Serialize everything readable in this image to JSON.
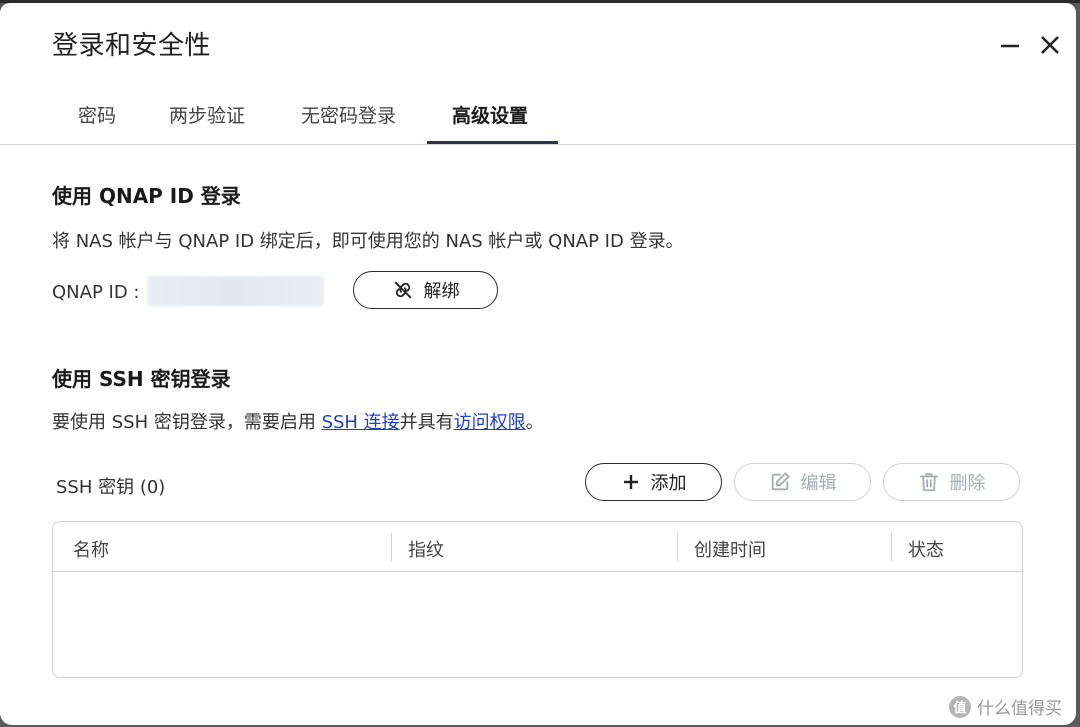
{
  "window": {
    "title": "登录和安全性",
    "minimize_icon": "minimize-icon",
    "close_icon": "close-icon"
  },
  "tabs": [
    {
      "label": "密码",
      "active": false
    },
    {
      "label": "两步验证",
      "active": false
    },
    {
      "label": "无密码登录",
      "active": false
    },
    {
      "label": "高级设置",
      "active": true
    }
  ],
  "qnap_section": {
    "heading": "使用 QNAP ID 登录",
    "description": "将 NAS 帐户与 QNAP ID 绑定后，即可使用您的 NAS 帐户或 QNAP ID 登录。",
    "id_label": "QNAP ID :",
    "unbind_button": {
      "label": "解绑",
      "icon": "unlink-icon"
    }
  },
  "ssh_section": {
    "heading": "使用 SSH 密钥登录",
    "description_prefix": "要使用 SSH 密钥登录，需要启用 ",
    "link_ssh": "SSH 连接",
    "description_middle": "并具有",
    "link_access": "访问权限",
    "description_suffix": "。",
    "keys_count_label": "SSH 密钥 (0)",
    "buttons": {
      "add": {
        "label": "添加",
        "icon": "plus-icon",
        "enabled": true
      },
      "edit": {
        "label": "编辑",
        "icon": "edit-icon",
        "enabled": false
      },
      "delete": {
        "label": "删除",
        "icon": "trash-icon",
        "enabled": false
      }
    },
    "table": {
      "columns": [
        "名称",
        "指纹",
        "创建时间",
        "状态"
      ],
      "rows": []
    }
  },
  "colors": {
    "accent_dark": "#2f3148",
    "link": "#1f3fc7",
    "disabled": "#a7acb3"
  },
  "watermark": {
    "badge": "值",
    "text": "什么值得买"
  }
}
